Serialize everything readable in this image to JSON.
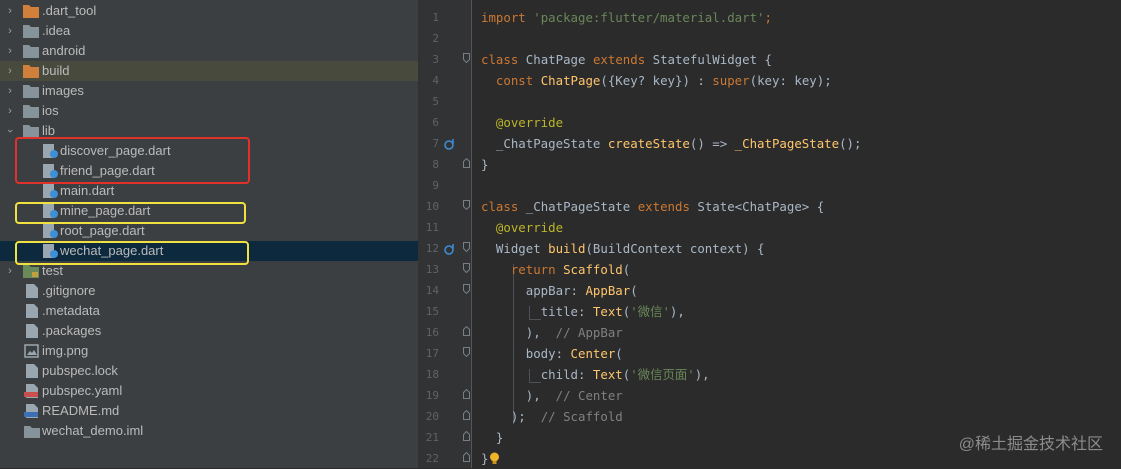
{
  "project_tree": {
    "items": [
      {
        "name": ".dart_tool",
        "icon": "orange-folder-icon"
      },
      {
        "name": ".idea",
        "icon": "folder-icon"
      },
      {
        "name": "android",
        "icon": "folder-icon"
      },
      {
        "name": "build",
        "icon": "orange-folder-icon"
      },
      {
        "name": "images",
        "icon": "folder-icon"
      },
      {
        "name": "ios",
        "icon": "folder-icon"
      },
      {
        "name": "lib",
        "icon": "folder-icon"
      },
      {
        "name": "discover_page.dart",
        "icon": "dart-file-icon"
      },
      {
        "name": "friend_page.dart",
        "icon": "dart-file-icon"
      },
      {
        "name": "main.dart",
        "icon": "dart-file-icon"
      },
      {
        "name": "mine_page.dart",
        "icon": "dart-file-icon"
      },
      {
        "name": "root_page.dart",
        "icon": "dart-file-icon"
      },
      {
        "name": "wechat_page.dart",
        "icon": "dart-file-icon"
      },
      {
        "name": "test",
        "icon": "test-folder-icon"
      },
      {
        "name": ".gitignore",
        "icon": "file-icon"
      },
      {
        "name": ".metadata",
        "icon": "file-icon"
      },
      {
        "name": ".packages",
        "icon": "file-icon"
      },
      {
        "name": "img.png",
        "icon": "image-file-icon"
      },
      {
        "name": "pubspec.lock",
        "icon": "file-icon"
      },
      {
        "name": "pubspec.yaml",
        "icon": "yaml-file-icon"
      },
      {
        "name": "README.md",
        "icon": "markdown-file-icon"
      },
      {
        "name": "wechat_demo.iml",
        "icon": "iml-file-icon"
      }
    ],
    "highlight_colors": {
      "red": "#e0312b",
      "yellow": "#f0e040"
    }
  },
  "editor": {
    "line_numbers": [
      "1",
      "2",
      "3",
      "4",
      "5",
      "6",
      "7",
      "8",
      "9",
      "10",
      "11",
      "12",
      "13",
      "14",
      "15",
      "16",
      "17",
      "18",
      "19",
      "20",
      "21",
      "22"
    ],
    "code": {
      "l1_kw": "import",
      "l1_str": "'package:flutter/material.dart'",
      "l1_end": ";",
      "l3_kw1": "class",
      "l3_id1": "ChatPage",
      "l3_kw2": "extends",
      "l3_id2": "StatefulWidget {",
      "l4_kw1": "const",
      "l4_fn": "ChatPage",
      "l4_id1": "({Key? key}) : ",
      "l4_kw2": "super",
      "l4_id2": "(key: key);",
      "l6_ann": "@override",
      "l7_id1": "_ChatPageState ",
      "l7_fn": "createState",
      "l7_id2": "() => ",
      "l7_fn2": "_ChatPageState",
      "l7_id3": "();",
      "l8_id": "}",
      "l10_kw1": "class",
      "l10_id1": "_ChatPageState",
      "l10_kw2": "extends",
      "l10_id2": "State<ChatPage> {",
      "l11_ann": "@override",
      "l12_id1": "Widget ",
      "l12_fn": "build",
      "l12_id2": "(BuildContext context) {",
      "l13_kw": "return",
      "l13_fn": "Scaffold",
      "l13_id": "(",
      "l14_id": "appBar: ",
      "l14_fn": "AppBar",
      "l14_id2": "(",
      "l15_id": "title: ",
      "l15_fn": "Text",
      "l15_id2": "(",
      "l15_str": "'微信'",
      "l15_id3": "),",
      "l16_id": "),",
      "l16_cmt": "// AppBar",
      "l17_id": "body: ",
      "l17_fn": "Center",
      "l17_id2": "(",
      "l18_id": "child: ",
      "l18_fn": "Text",
      "l18_id2": "(",
      "l18_str": "'微信页面'",
      "l18_id3": "),",
      "l19_id": "),",
      "l19_cmt": "// Center",
      "l20_id": ");",
      "l20_cmt": "// Scaffold",
      "l21_id": "}",
      "l22_id": "}"
    }
  },
  "watermark": "@稀土掘金技术社区"
}
